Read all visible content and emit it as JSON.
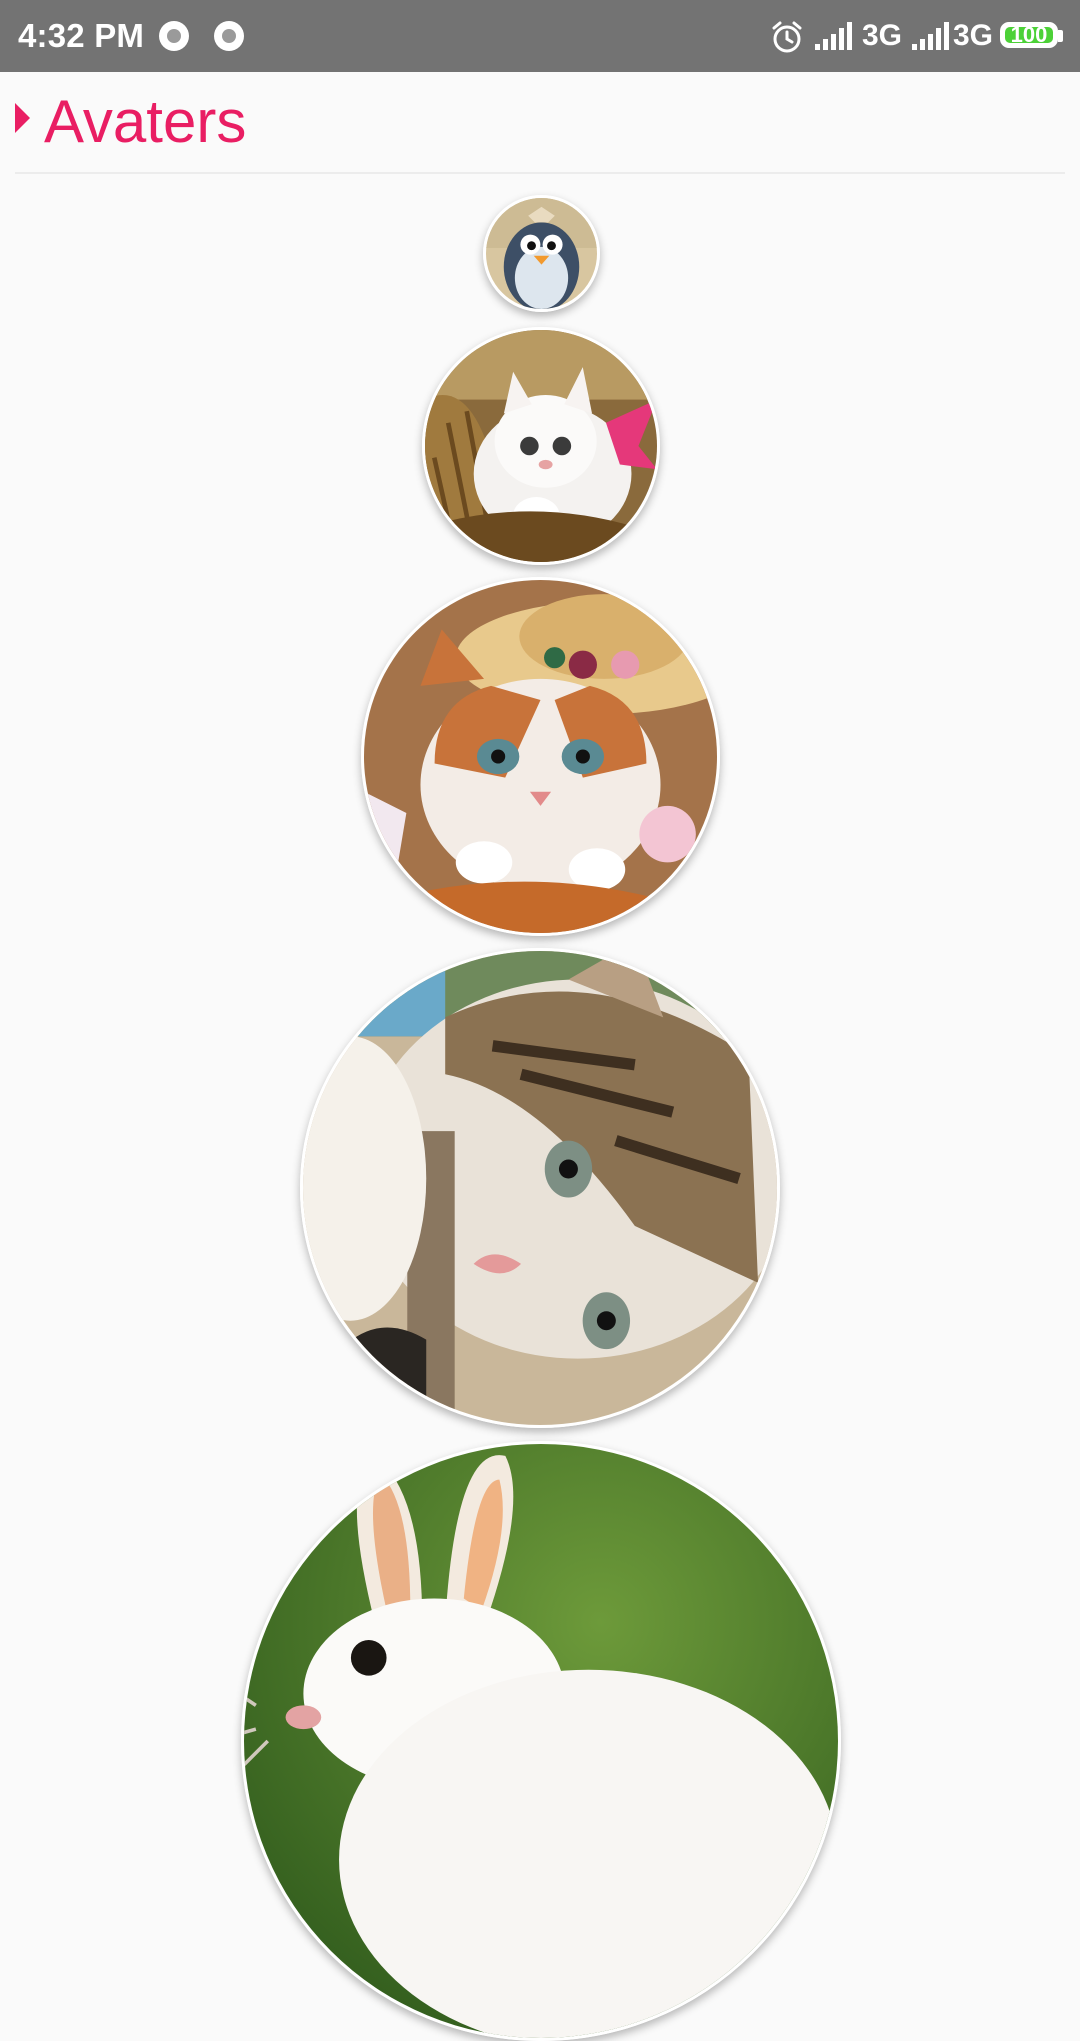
{
  "status_bar": {
    "time": "4:32 PM",
    "network_1": "3G",
    "network_2": "3G",
    "battery": "100",
    "icons": [
      "notification-dot-icon",
      "notification-dot-icon",
      "alarm-icon",
      "signal-icon",
      "signal-icon",
      "battery-icon"
    ]
  },
  "header": {
    "title": "Avaters",
    "accent_color": "#e91e63",
    "icon": "expand-arrow-icon"
  },
  "avatars": [
    {
      "subject": "penguin",
      "icon": "penguin-avatar"
    },
    {
      "subject": "white kitten in basket",
      "icon": "kitten-avatar"
    },
    {
      "subject": "kitten with straw hat",
      "icon": "kitten-hat-avatar"
    },
    {
      "subject": "tabby kitten",
      "icon": "tabby-kitten-avatar"
    },
    {
      "subject": "white rabbit",
      "icon": "rabbit-avatar"
    }
  ]
}
